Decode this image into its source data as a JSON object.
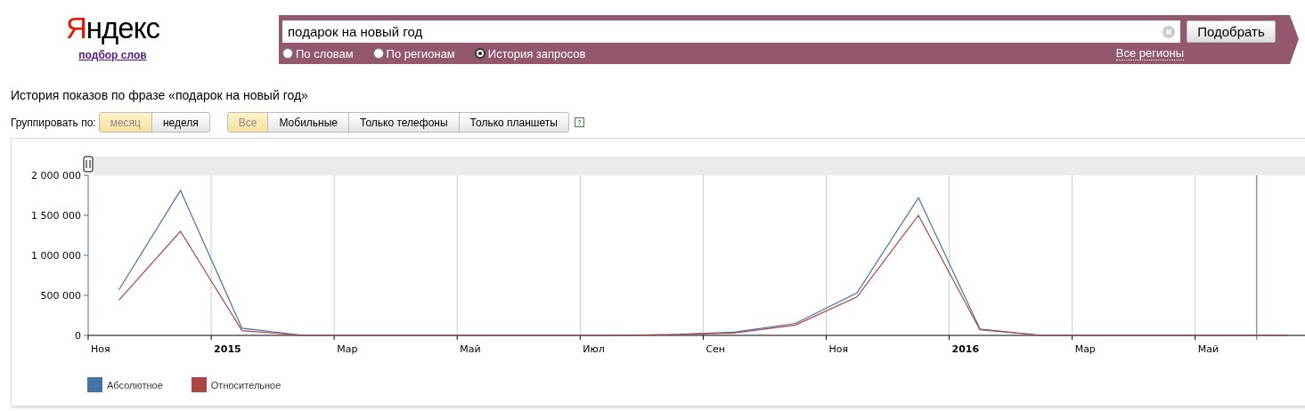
{
  "logo": {
    "text": "Яндекс",
    "subtitle": "подбор слов"
  },
  "search": {
    "value": "подарок на новый год",
    "button": "Подобрать",
    "modes": [
      {
        "label": "По словам",
        "selected": false
      },
      {
        "label": "По регионам",
        "selected": false
      },
      {
        "label": "История запросов",
        "selected": true
      }
    ],
    "region": "Все регионы"
  },
  "heading": "История показов по фразе «подарок на новый год»",
  "grouping": {
    "label": "Группировать по:",
    "options": [
      {
        "label": "месяц",
        "selected": true
      },
      {
        "label": "неделя",
        "selected": false
      }
    ]
  },
  "devices": {
    "options": [
      {
        "label": "Все",
        "selected": true
      },
      {
        "label": "Мобильные",
        "selected": false
      },
      {
        "label": "Только телефоны",
        "selected": false
      },
      {
        "label": "Только планшеты",
        "selected": false
      }
    ],
    "help": "?"
  },
  "chart": {
    "chart_data": {
      "type": "line",
      "categories": [
        "Ноя",
        null,
        "2015",
        null,
        "Мар",
        null,
        "Май",
        null,
        "Июл",
        null,
        "Сен",
        null,
        "Ноя",
        null,
        "2016",
        null,
        "Мар",
        null,
        "Май",
        null
      ],
      "series": [
        {
          "name": "Абсолютное",
          "color": "#4572a7",
          "values": [
            570000,
            1810000,
            90000,
            0,
            0,
            0,
            0,
            0,
            0,
            10000,
            40000,
            150000,
            530000,
            1720000,
            80000,
            0,
            0,
            0,
            0,
            0
          ]
        },
        {
          "name": "Относительное",
          "color": "#aa4643",
          "values": [
            440000,
            1300000,
            60000,
            0,
            0,
            0,
            0,
            0,
            0,
            10000,
            30000,
            130000,
            480000,
            1500000,
            70000,
            0,
            0,
            0,
            0,
            0
          ]
        }
      ],
      "ylim": [
        0,
        2000000
      ],
      "yticks": [
        {
          "value": 0,
          "label": "0"
        },
        {
          "value": 500000,
          "label": "500 000"
        },
        {
          "value": 1000000,
          "label": "1 000 000"
        },
        {
          "value": 1500000,
          "label": "1 500 000"
        },
        {
          "value": 2000000,
          "label": "2 000 000"
        }
      ]
    }
  }
}
